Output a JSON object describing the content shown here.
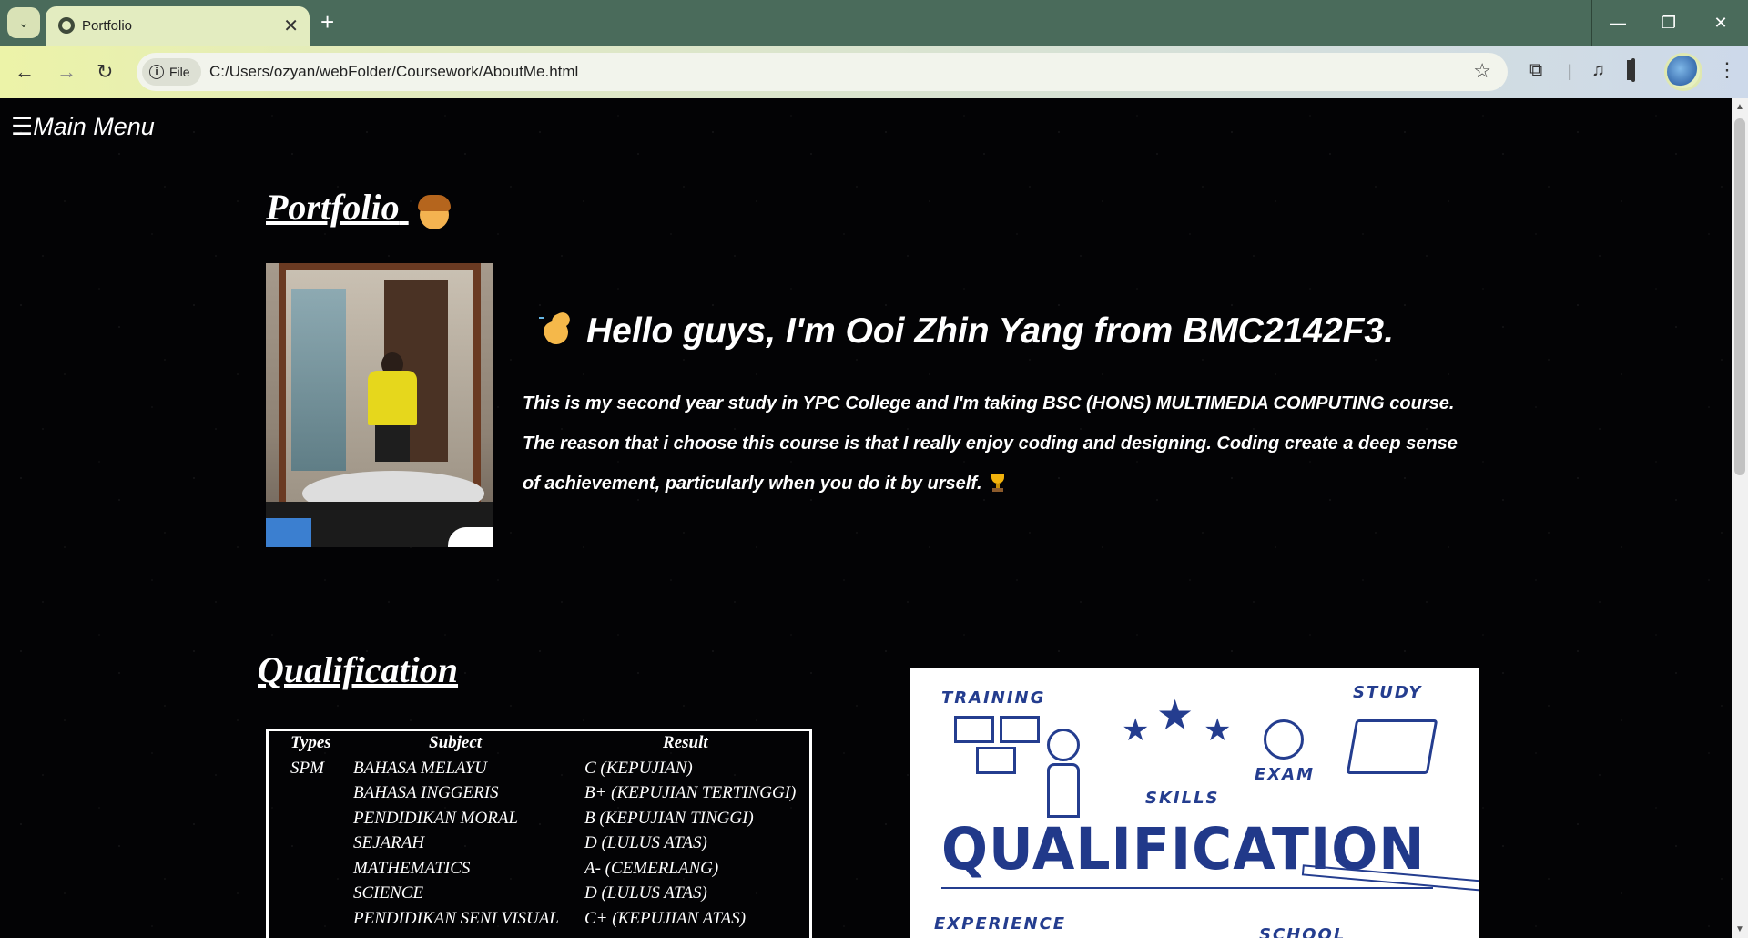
{
  "browser": {
    "tab_title": "Portfolio",
    "new_tab_label": "+",
    "address_chip": "File",
    "url": "C:/Users/ozyan/webFolder/Coursework/AboutMe.html"
  },
  "page": {
    "menu_label": "Main Menu",
    "menu_icon": "☰",
    "title": "Portfolio",
    "greeting": "Hello guys, I'm Ooi Zhin Yang from BMC2142F3.",
    "about_text": "This is my second year study in YPC College and I'm taking BSC (HONS) MULTIMEDIA COMPUTING course. The reason that i choose this course is that I really enjoy coding and designing. Coding create a deep sense of achievement, particularly when you do it by urself.",
    "qualification_title": "Qualification"
  },
  "qualification_table": {
    "headers": [
      "Types",
      "Subject",
      "Result"
    ],
    "rows": [
      {
        "type": "SPM",
        "subject": "BAHASA MELAYU",
        "result": "C (KEPUJIAN)"
      },
      {
        "type": "",
        "subject": "BAHASA INGGERIS",
        "result": "B+ (KEPUJIAN TERTINGGI)"
      },
      {
        "type": "",
        "subject": "PENDIDIKAN MORAL",
        "result": "B (KEPUJIAN TINGGI)"
      },
      {
        "type": "",
        "subject": "SEJARAH",
        "result": "D (LULUS ATAS)"
      },
      {
        "type": "",
        "subject": "MATHEMATICS",
        "result": "A- (CEMERLANG)"
      },
      {
        "type": "",
        "subject": "SCIENCE",
        "result": "D (LULUS ATAS)"
      },
      {
        "type": "",
        "subject": "PENDIDIKAN SENI VISUAL",
        "result": "C+ (KEPUJIAN ATAS)"
      }
    ]
  },
  "qualification_image": {
    "heading": "QUALIFICATION",
    "words": {
      "training": "TRAINING",
      "study": "STUDY",
      "exam": "EXAM",
      "skills": "SKILLS",
      "experience": "EXPERIENCE",
      "school": "SCHOOL"
    }
  }
}
